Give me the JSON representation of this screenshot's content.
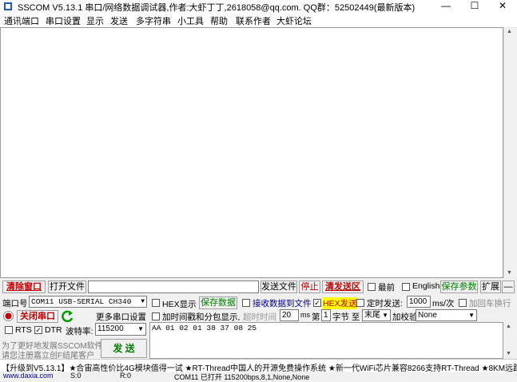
{
  "window": {
    "title": "SSCOM V5.13.1 串口/网络数据调试器,作者:大虾丁丁,2618058@qq.com. QQ群：52502449(最新版本)",
    "minimize": "—",
    "maximize": "☐",
    "close": "✕"
  },
  "menu": [
    "通讯端口",
    "串口设置",
    "显示",
    "发送",
    "多字符串",
    "小工具",
    "帮助",
    "联系作者",
    "大虾论坛"
  ],
  "toolbar": {
    "clear_window": "清除窗口",
    "open_file": "打开文件",
    "send_file": "发送文件",
    "stop": "停止",
    "clear_send": "清发送区",
    "topmost": "最前",
    "english": "English",
    "save_params": "保存参数",
    "expand": "扩展",
    "collapse": "—"
  },
  "port": {
    "label": "端口号",
    "value": "COM11 USB-SERIAL CH340",
    "close_port": "关闭串口",
    "more_settings": "更多串口设置",
    "rts": "RTS",
    "dtr": "DTR",
    "baud_label": "波特率:",
    "baud_value": "115200",
    "promo_line1": "为了更好地发展SSCOM软件",
    "promo_line2": "请您注册嘉立创F结尾客户",
    "send_button": "发  送"
  },
  "options": {
    "hex_display": "HEX显示",
    "save_data": "保存数据",
    "recv_to_file": "接收数据到文件",
    "hex_send": "HEX发送",
    "timed_send": "定时发送:",
    "timed_ms": "1000",
    "ms_unit": "ms/次",
    "append_crlf": "加回车换行",
    "add_timestamp": "加时间戳和分包显示,",
    "timeout_label": "超时时间",
    "timeout_value": "20",
    "ms": "ms",
    "di": "第",
    "byte_index": "1",
    "byte_to": "字节 至",
    "end_label": "末尾",
    "checksum_label": "加校验",
    "checksum_value": "None"
  },
  "send_text": "AA 01 02 01 38 37 08 25",
  "ticker": "【升级到V5.13.1】★合宙高性价比4G模块值得一试 ★RT-Thread中国人的开源免费操作系统 ★新一代WiFi芯片兼容8266支持RT-Thread ★8KM远距",
  "status": {
    "website": "www.daxia.com",
    "s": "S:0",
    "r": "R:0",
    "port_state": "COM11 已打开  115200bps,8,1,None,None"
  },
  "colors": {
    "red": "#c00000",
    "green": "#008000",
    "highlight": "#ffff00"
  }
}
